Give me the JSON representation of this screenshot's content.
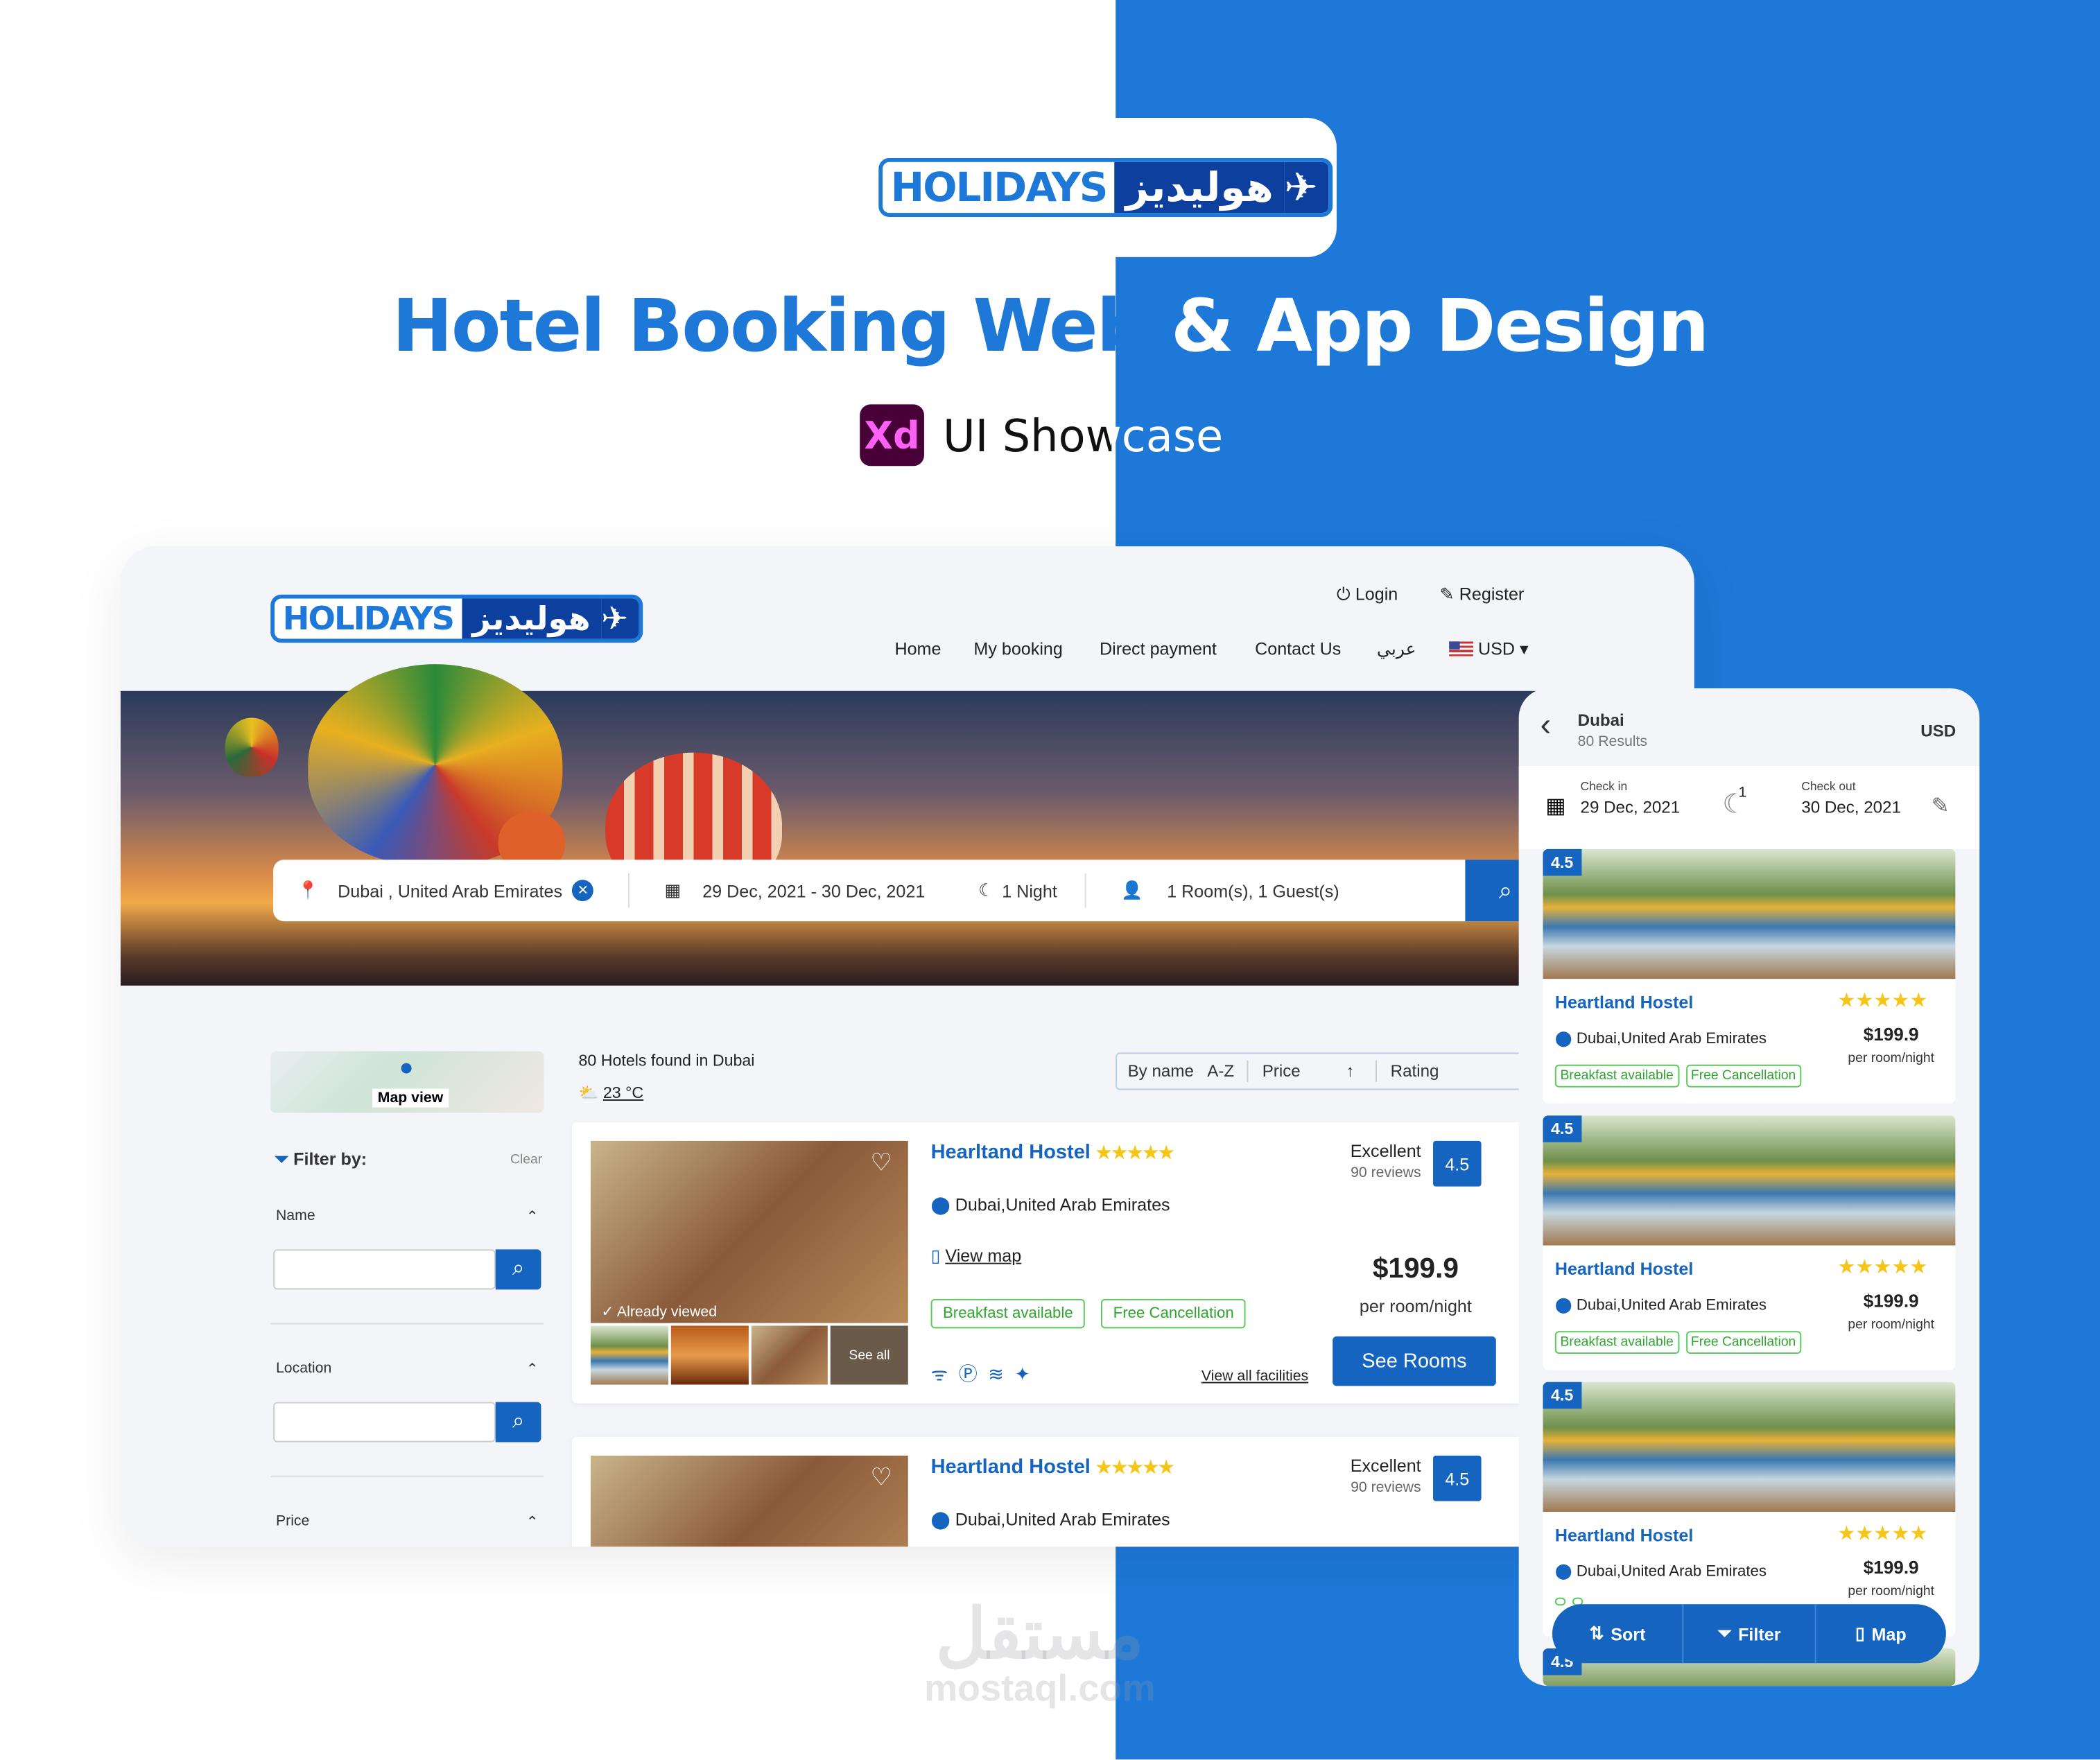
{
  "showcase": {
    "title_part1": "Hotel Booking Web",
    "title_part2": "& App Design",
    "xd_label": "Xd",
    "subtitle": "UI Showcase",
    "logo_en": "HOLIDAYS",
    "logo_ar": "هوليديز",
    "watermark_ar": "مستقل",
    "watermark_en": "mostaql.com"
  },
  "header": {
    "login": "Login",
    "register": "Register",
    "nav": [
      "Home",
      "My booking",
      "Direct payment",
      "Contact Us",
      "عربي"
    ],
    "currency": "USD"
  },
  "search": {
    "destination": "Dubai , United Arab Emirates",
    "dates": "29 Dec, 2021 - 30 Dec, 2021",
    "nights": "1 Night",
    "guests": "1 Room(s), 1 Guest(s)"
  },
  "sidebar": {
    "map_label": "Map view",
    "filter_label": "Filter by:",
    "clear": "Clear",
    "sections": [
      "Name",
      "Location",
      "Price"
    ]
  },
  "results": {
    "count_text": "80 Hotels found in Dubai",
    "weather": "23 °C",
    "sort": [
      "By name",
      "A-Z",
      "Price",
      "Rating"
    ]
  },
  "hotels": [
    {
      "name": "Hearltand Hostel",
      "stars": 5,
      "location": "Dubai,United Arab Emirates",
      "view_map": "View map",
      "rating_word": "Excellent",
      "reviews": "90 reviews",
      "rating": "4.5",
      "price": "$199.9",
      "price_unit": "per room/night",
      "tags": [
        "Breakfast available",
        "Free Cancellation"
      ],
      "already_viewed": "Already viewed",
      "see_all": "See all",
      "facilities_link": "View all facilities",
      "cta": "See Rooms"
    },
    {
      "name": "Heartland Hostel",
      "stars": 5,
      "location": "Dubai,United Arab Emirates",
      "rating_word": "Excellent",
      "reviews": "90 reviews",
      "rating": "4.5"
    }
  ],
  "mobile": {
    "city": "Dubai",
    "results": "80 Results",
    "currency": "USD",
    "checkin_label": "Check in",
    "checkin": "29 Dec, 2021",
    "nights": "1",
    "checkout_label": "Check out",
    "checkout": "30 Dec, 2021",
    "hotels": [
      {
        "rating": "4.5",
        "name": "Heartland Hostel",
        "location": "Dubai,United Arab Emirates",
        "price": "$199.9",
        "unit": "per room/night",
        "tags": [
          "Breakfast available",
          "Free Cancellation"
        ]
      },
      {
        "rating": "4.5",
        "name": "Heartland Hostel",
        "location": "Dubai,United Arab Emirates",
        "price": "$199.9",
        "unit": "per room/night",
        "tags": [
          "Breakfast available",
          "Free Cancellation"
        ]
      },
      {
        "rating": "4.5",
        "name": "Heartland Hostel",
        "location": "Dubai,United Arab Emirates",
        "price": "$199.9",
        "unit": "per room/night"
      },
      {
        "rating": "4.5"
      }
    ],
    "bar": [
      "Sort",
      "Filter",
      "Map"
    ]
  },
  "colors": {
    "brand_blue": "#1e78d8",
    "primary": "#1565c0",
    "tag_green": "#2fa52f",
    "star": "#f5c518"
  }
}
